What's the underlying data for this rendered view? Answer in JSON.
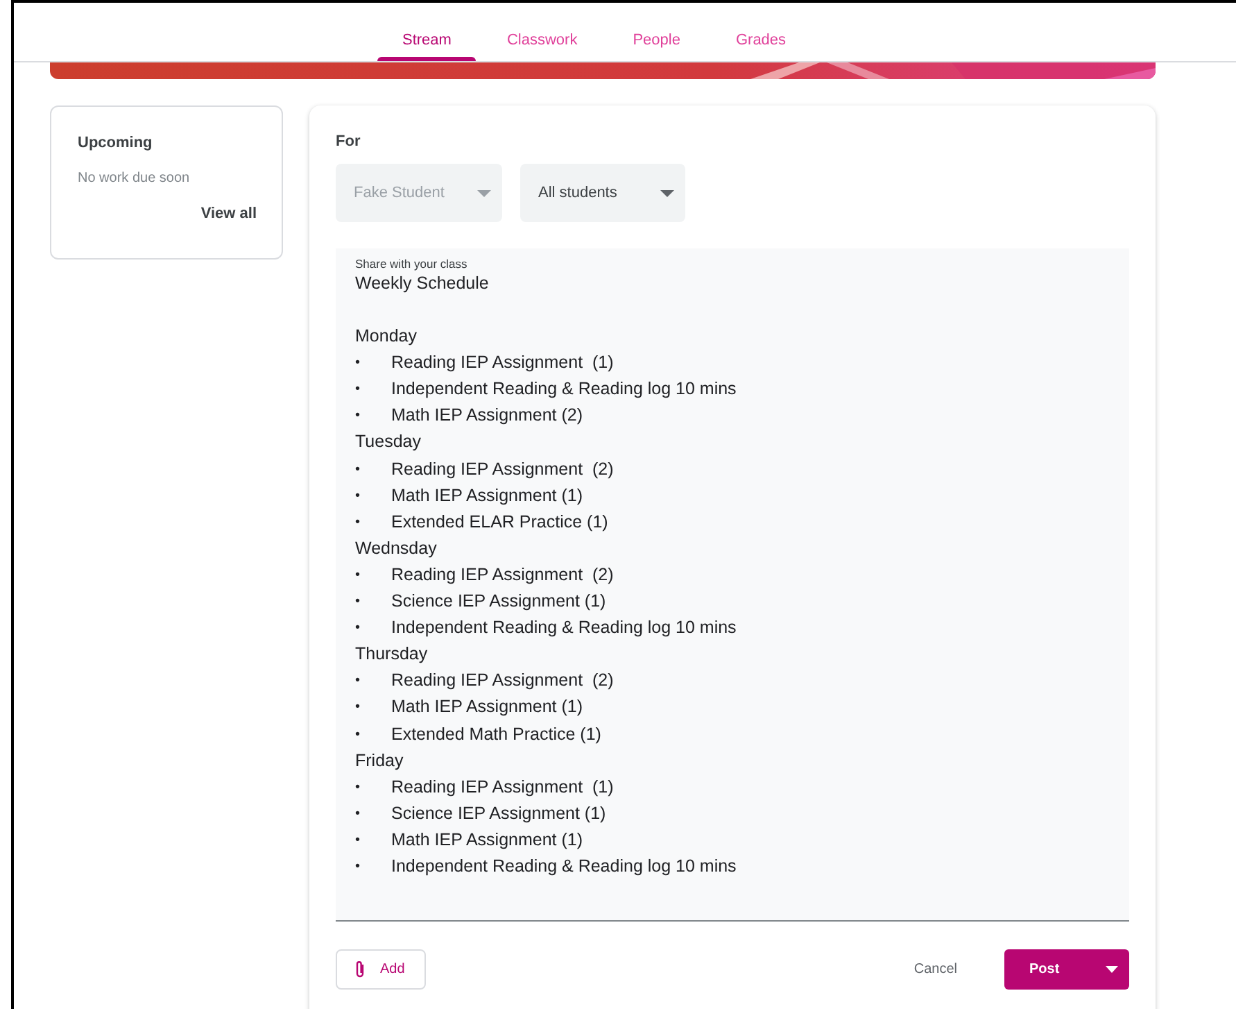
{
  "tabs": [
    {
      "label": "Stream",
      "selected": true
    },
    {
      "label": "Classwork",
      "selected": false
    },
    {
      "label": "People",
      "selected": false
    },
    {
      "label": "Grades",
      "selected": false
    }
  ],
  "upcoming": {
    "title": "Upcoming",
    "message": "No work due soon",
    "link": "View all"
  },
  "composer": {
    "for_label": "For",
    "dropdowns": [
      {
        "value": "Fake Student",
        "disabled": true
      },
      {
        "value": "All students",
        "disabled": false
      }
    ],
    "placeholder": "Share with your class",
    "title": "Weekly Schedule",
    "days": [
      {
        "name": "Monday",
        "items": [
          "Reading IEP Assignment  (1)",
          "Independent Reading & Reading log 10 mins",
          "Math IEP Assignment (2)"
        ]
      },
      {
        "name": "Tuesday",
        "items": [
          "Reading IEP Assignment  (2)",
          "Math IEP Assignment (1)",
          "Extended ELAR Practice (1)"
        ]
      },
      {
        "name": "Wednsday",
        "items": [
          "Reading IEP Assignment  (2)",
          "Science IEP Assignment (1)",
          "Independent Reading & Reading log 10 mins"
        ]
      },
      {
        "name": "Thursday",
        "items": [
          "Reading IEP Assignment  (2)",
          "Math IEP Assignment (1)",
          "Extended Math Practice (1)"
        ]
      },
      {
        "name": "Friday",
        "items": [
          "Reading IEP Assignment  (1)",
          "Science IEP Assignment (1)",
          "Math IEP Assignment (1)",
          "Independent Reading & Reading log 10 mins"
        ]
      }
    ],
    "bullet": "•",
    "add_button": "Add",
    "cancel_button": "Cancel",
    "post_button": "Post"
  }
}
